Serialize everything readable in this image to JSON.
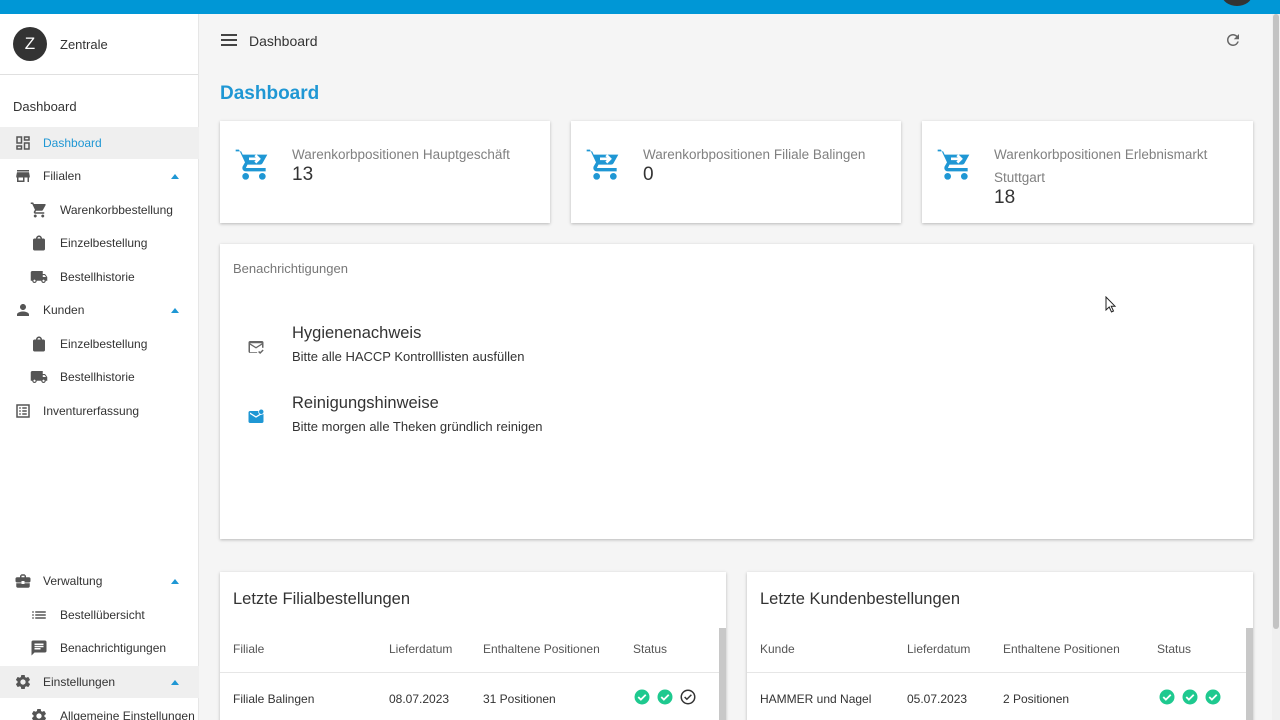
{
  "app": {
    "accent": "#1f97d4",
    "topbar_color": "#0097d6"
  },
  "user": {
    "initial": "Z",
    "name": "Zentrale"
  },
  "sidebar": {
    "section_label": "Dashboard",
    "items": [
      {
        "label": "Dashboard",
        "icon": "dashboard-icon",
        "active": true
      },
      {
        "label": "Filialen",
        "icon": "store-icon",
        "expanded": true
      },
      {
        "label": "Warenkorbbestellung",
        "icon": "cart-icon"
      },
      {
        "label": "Einzelbestellung",
        "icon": "bag-icon"
      },
      {
        "label": "Bestellhistorie",
        "icon": "truck-icon"
      },
      {
        "label": "Kunden",
        "icon": "person-icon",
        "expanded": true
      },
      {
        "label": "Einzelbestellung",
        "icon": "bag-icon"
      },
      {
        "label": "Bestellhistorie",
        "icon": "truck-icon"
      },
      {
        "label": "Inventurerfassung",
        "icon": "list-icon"
      },
      {
        "label": "Verwaltung",
        "icon": "briefcase-icon",
        "expanded": true
      },
      {
        "label": "Bestellübersicht",
        "icon": "list-lines-icon"
      },
      {
        "label": "Benachrichtigungen",
        "icon": "message-icon"
      },
      {
        "label": "Einstellungen",
        "icon": "gear-icon",
        "expanded": true
      },
      {
        "label": "Allgemeine Einstellungen",
        "icon": "gear-icon"
      }
    ]
  },
  "header": {
    "breadcrumb": "Dashboard"
  },
  "main": {
    "title": "Dashboard",
    "stats": [
      {
        "label": "Warenkorbpositionen Hauptgeschäft",
        "value": "13"
      },
      {
        "label": "Warenkorbpositionen Filiale Balingen",
        "value": "0"
      },
      {
        "label": "Warenkorbpositionen Erlebnismarkt Stuttgart",
        "value": "18"
      }
    ],
    "notifications": {
      "title": "Benachrichtigungen",
      "items": [
        {
          "title": "Hygienenachweis",
          "text": "Bitte alle HACCP Kontrolllisten ausfüllen",
          "icon": "mail-check-icon"
        },
        {
          "title": "Reinigungshinweise",
          "text": "Bitte morgen alle Theken gründlich reinigen",
          "icon": "mail-unread-icon"
        }
      ]
    },
    "branch_orders": {
      "title": "Letzte Filialbestellungen",
      "columns": [
        "Filiale",
        "Lieferdatum",
        "Enthaltene Positionen",
        "Status"
      ],
      "rows": [
        {
          "name": "Filiale Balingen",
          "date": "08.07.2023",
          "positions": "31 Positionen",
          "status": [
            "done",
            "done",
            "outline"
          ]
        }
      ]
    },
    "customer_orders": {
      "title": "Letzte Kundenbestellungen",
      "columns": [
        "Kunde",
        "Lieferdatum",
        "Enthaltene Positionen",
        "Status"
      ],
      "rows": [
        {
          "name": "HAMMER und Nagel",
          "date": "05.07.2023",
          "positions": "2 Positionen",
          "status": [
            "done",
            "done",
            "done"
          ]
        }
      ]
    }
  }
}
